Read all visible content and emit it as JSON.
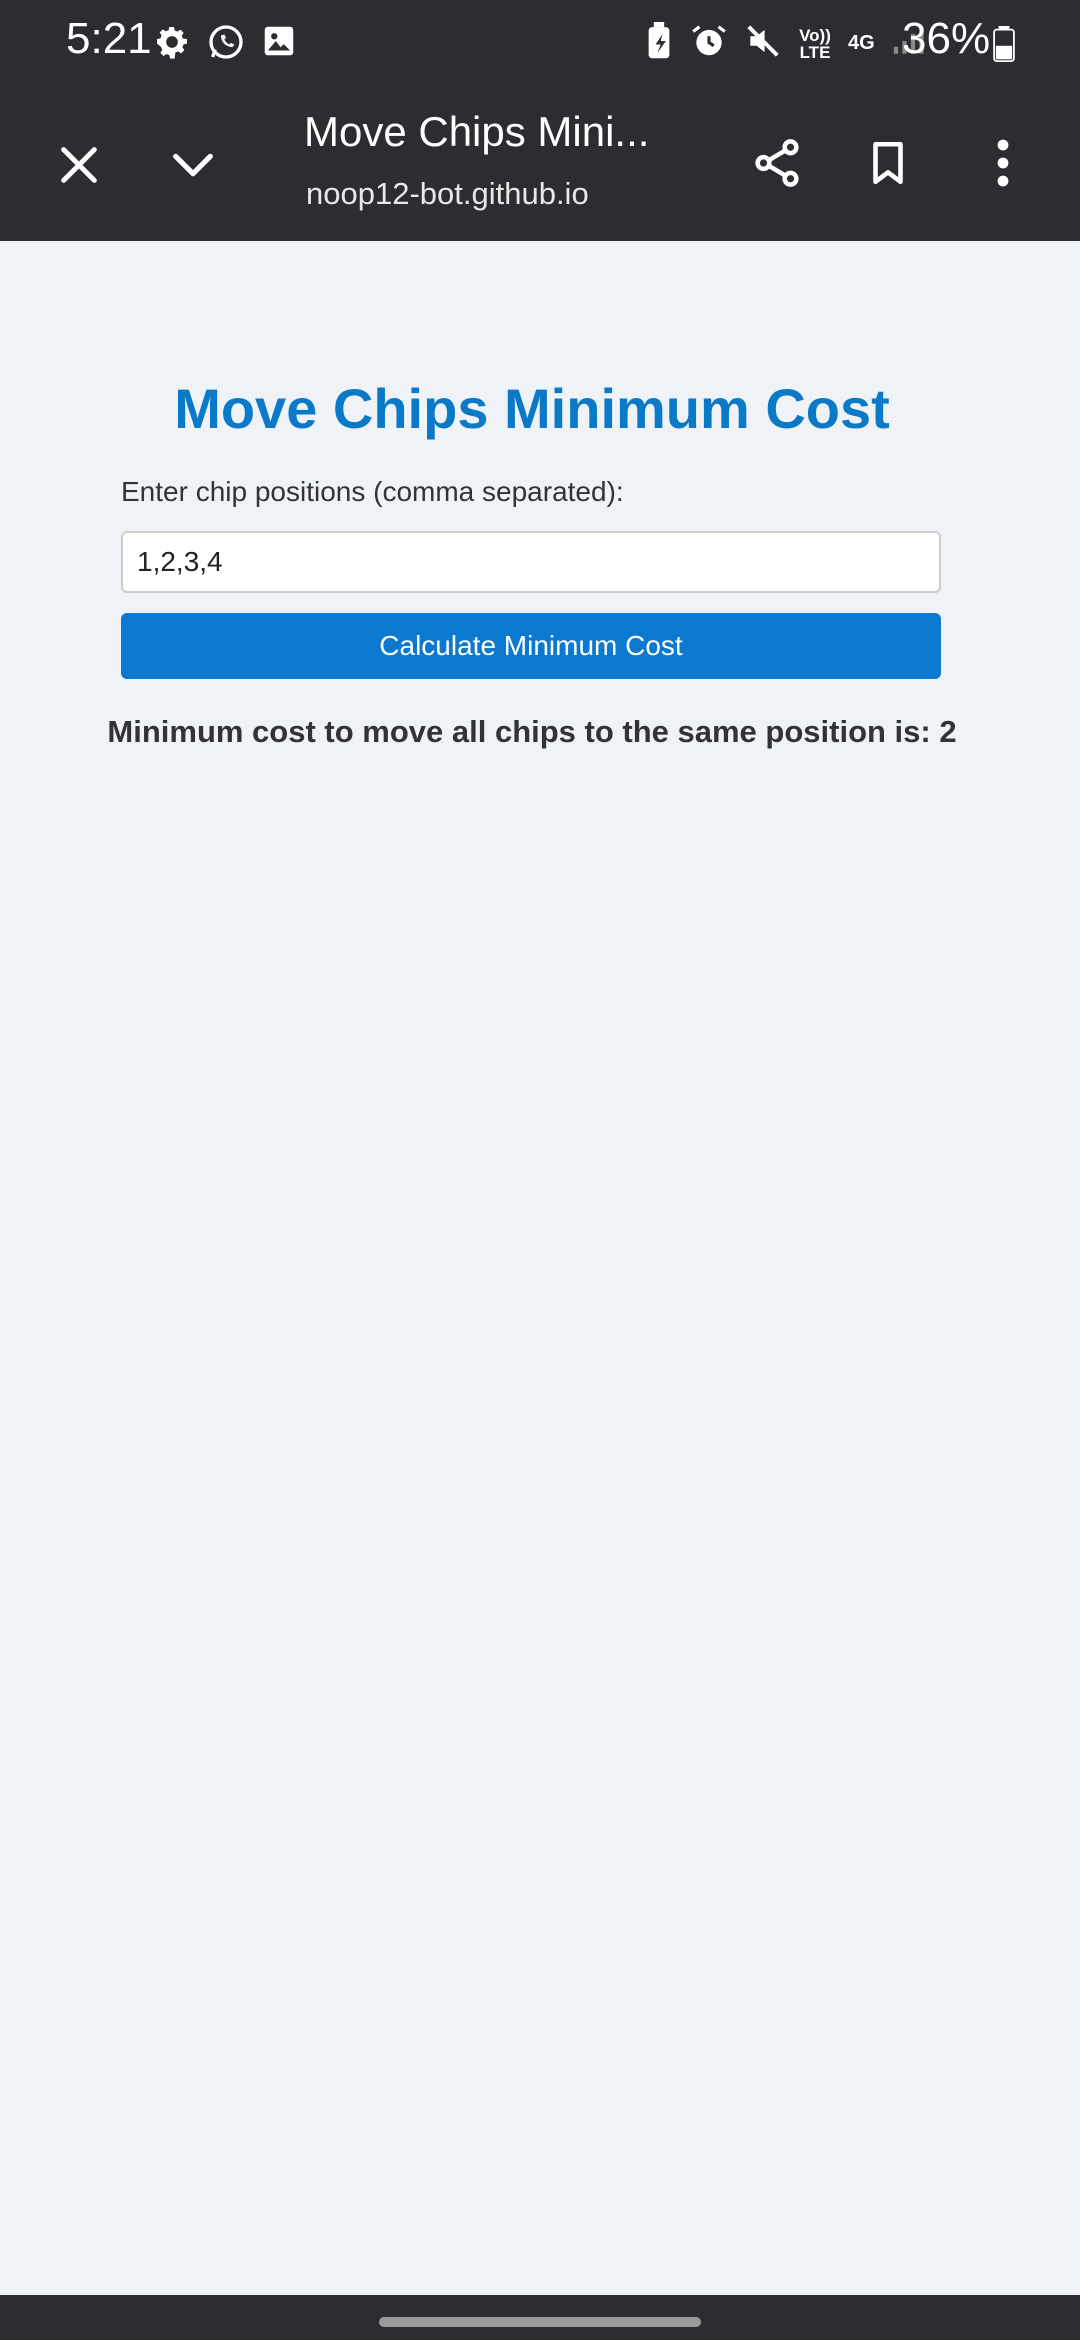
{
  "status_bar": {
    "time": "5:21",
    "left_icons": [
      "gear-icon",
      "whatsapp-icon",
      "image-icon"
    ],
    "right_icons": [
      "battery-saver-icon",
      "alarm-icon",
      "mute-icon",
      "volte-icon",
      "4g-icon",
      "signal-icon"
    ],
    "volte_label": "Vo)) LTE",
    "network_label": "4G",
    "battery_percent": "36%"
  },
  "toolbar": {
    "page_title": "Move Chips Mini...",
    "url": "noop12-bot.github.io",
    "icons": [
      "close-icon",
      "chevron-down-icon",
      "share-icon",
      "bookmark-icon",
      "more-vert-icon"
    ]
  },
  "main": {
    "heading": "Move Chips Minimum Cost",
    "input_label": "Enter chip positions (comma separated):",
    "input_value": "1,2,3,4",
    "button_label": "Calculate Minimum Cost",
    "result_text": "Minimum cost to move all chips to the same position is: 2"
  },
  "colors": {
    "accent": "#0a79c7",
    "button": "#0a79cf",
    "chrome": "#2b2d31",
    "page_bg": "#eff3f8"
  }
}
